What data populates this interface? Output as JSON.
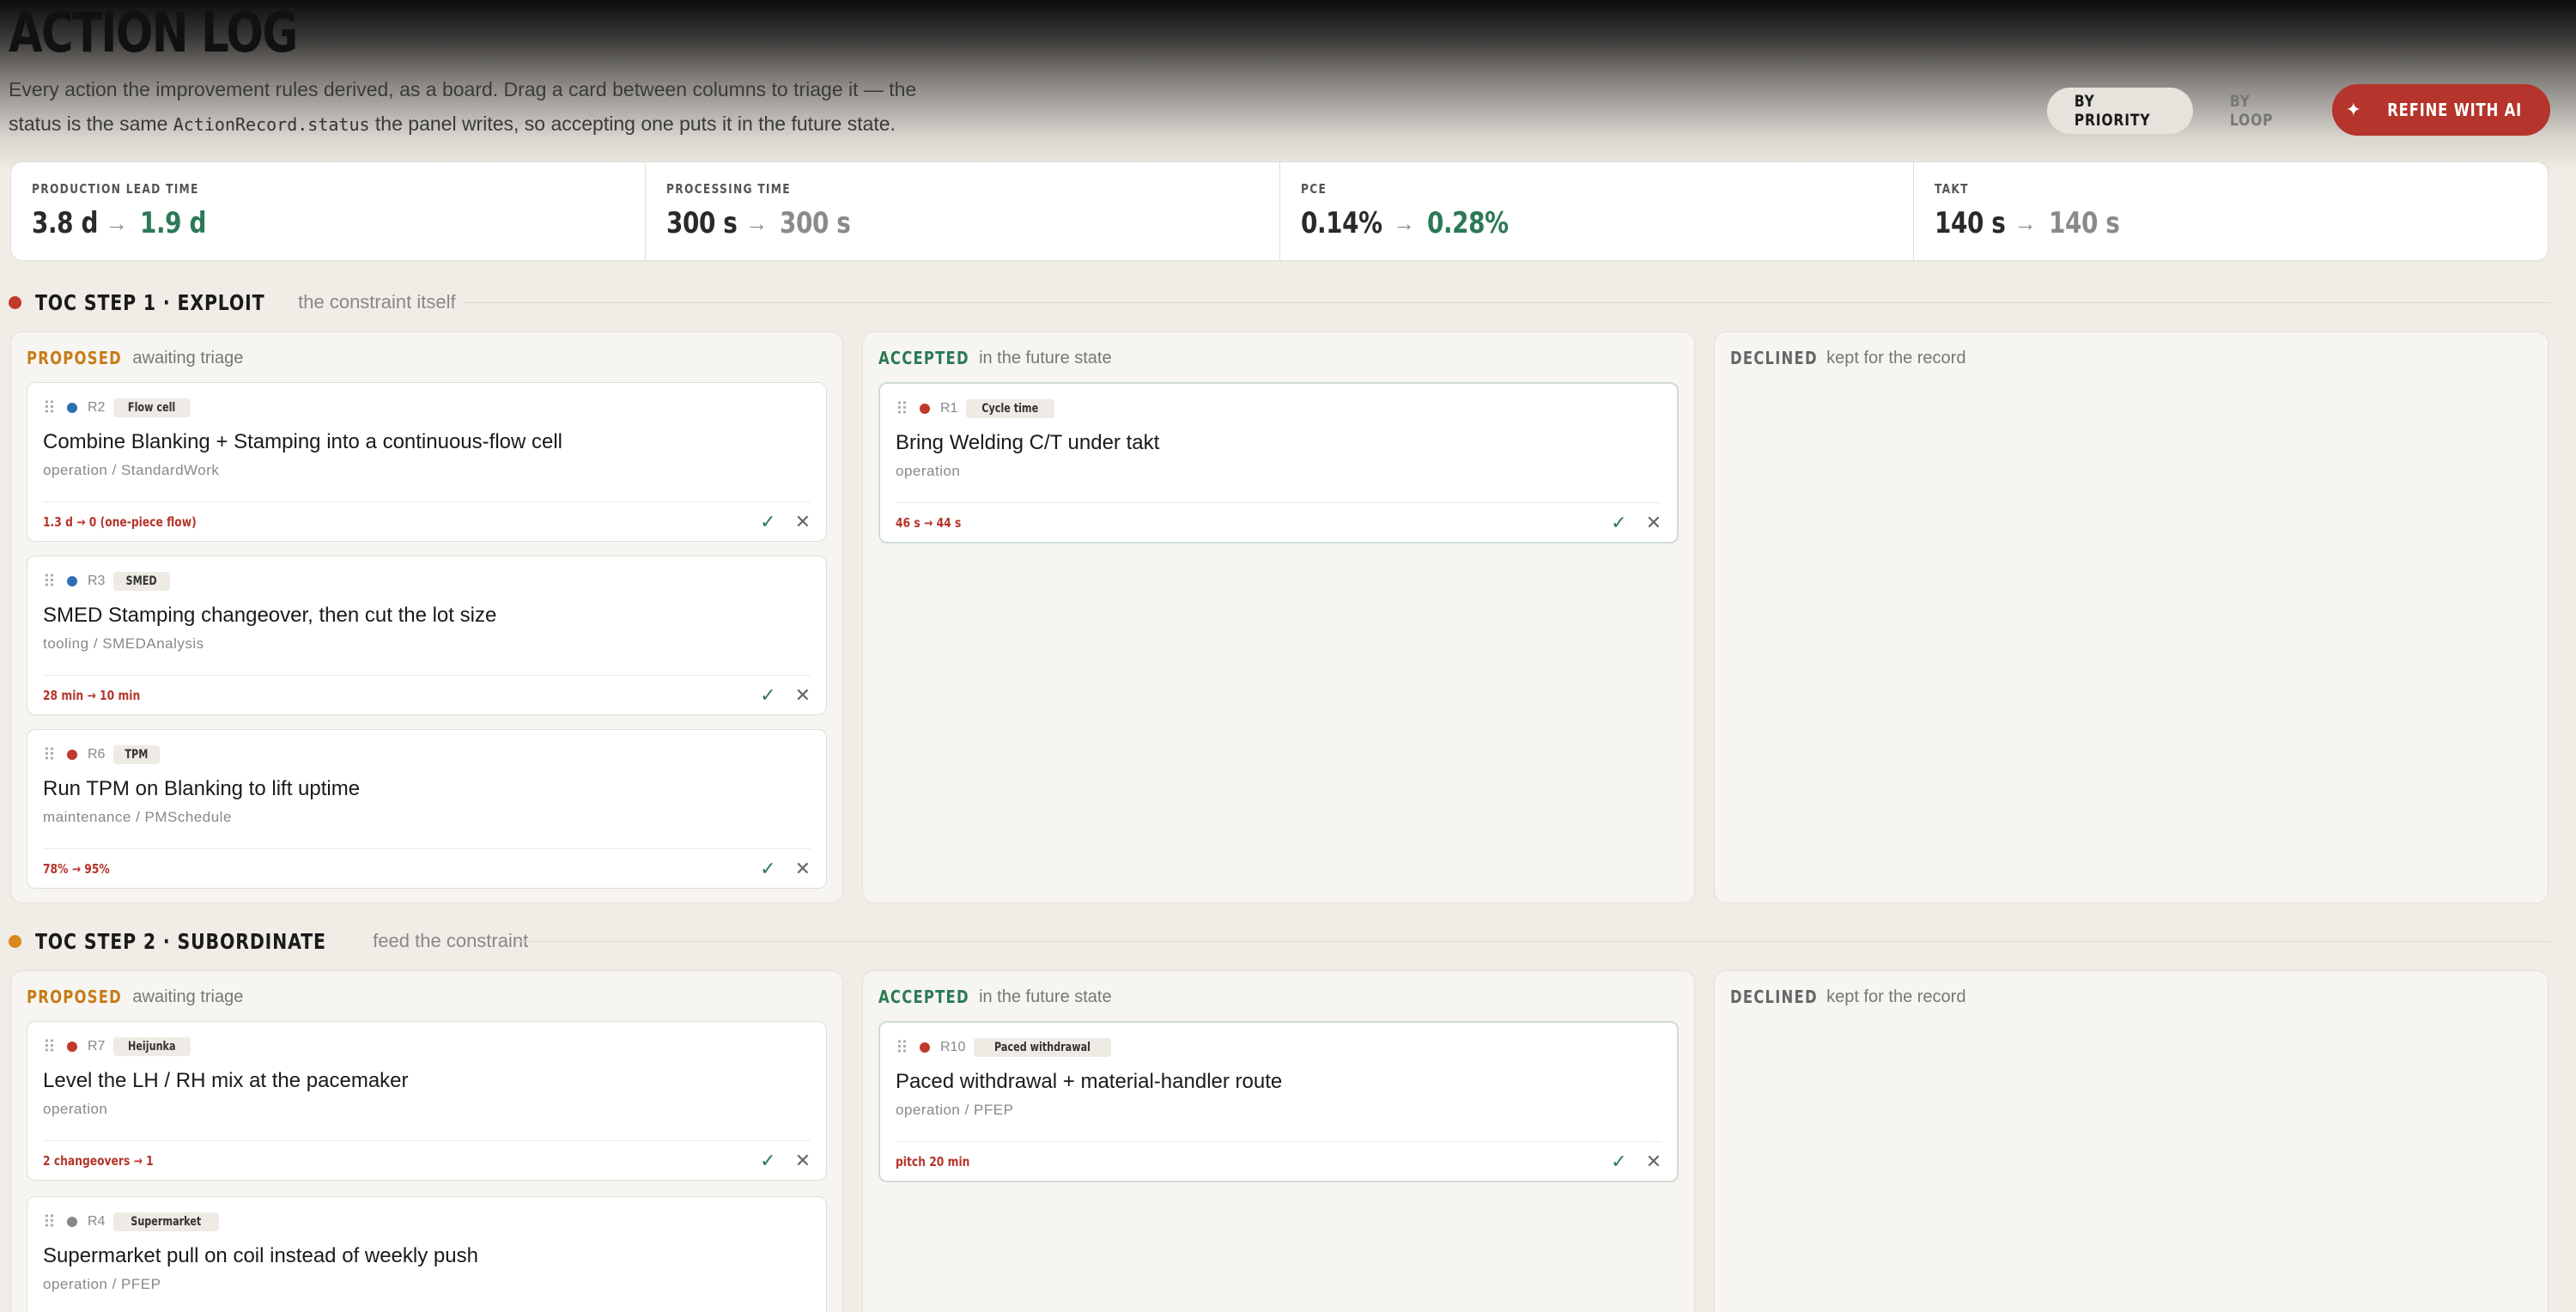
{
  "header": {
    "title": "ACTION LOG",
    "desc_1": "Every action the improvement rules derived, as a board. Drag a card between columns to triage it — the",
    "desc_2a": "status is the same ",
    "desc_code": "ActionRecord.status",
    "desc_2b": " the panel writes, so accepting one puts it in the future state.",
    "by_priority": "BY PRIORITY",
    "by_loop": "BY LOOP",
    "refine": "REFINE WITH AI"
  },
  "metrics": [
    {
      "label": "PRODUCTION LEAD TIME",
      "from": "3.8 d",
      "to": "1.9 d"
    },
    {
      "label": "PROCESSING TIME",
      "from": "300 s",
      "to": "300 s"
    },
    {
      "label": "PCE",
      "from": "0.14%",
      "to": "0.28%"
    },
    {
      "label": "TAKT",
      "from": "140 s",
      "to": "140 s"
    }
  ],
  "columns": {
    "proposed": {
      "title": "PROPOSED",
      "sub": "awaiting triage"
    },
    "accepted": {
      "title": "ACCEPTED",
      "sub": "in the future state"
    },
    "declined": {
      "title": "DECLINED",
      "sub": "kept for the record"
    }
  },
  "sections": [
    {
      "title": "TOC STEP 1 · EXPLOIT",
      "sub": "the constraint itself",
      "proposed": [
        {
          "id": "R2",
          "tag": "Flow cell",
          "title": "Combine Blanking + Stamping into a continuous-flow cell",
          "meta": "operation / StandardWork",
          "delta": "1.3 d → 0 (one-piece flow)"
        },
        {
          "id": "R3",
          "tag": "SMED",
          "title": "SMED Stamping changeover, then cut the lot size",
          "meta": "tooling / SMEDAnalysis",
          "delta": "28 min → 10 min"
        },
        {
          "id": "R6",
          "tag": "TPM",
          "title": "Run TPM on Blanking to lift uptime",
          "meta": "maintenance / PMSchedule",
          "delta": "78% → 95%"
        }
      ],
      "accepted": [
        {
          "id": "R1",
          "tag": "Cycle time",
          "title": "Bring Welding C/T under takt",
          "meta": "operation",
          "delta": "46 s → 44 s"
        }
      ]
    },
    {
      "title": "TOC STEP 2 · SUBORDINATE",
      "sub": "feed the constraint",
      "proposed": [
        {
          "id": "R7",
          "tag": "Heijunka",
          "title": "Level the LH / RH mix at the pacemaker",
          "meta": "operation",
          "delta": "2 changeovers → 1"
        },
        {
          "id": "R4",
          "tag": "Supermarket",
          "title": "Supermarket pull on coil instead of weekly push",
          "meta": "operation / PFEP",
          "delta": ""
        }
      ],
      "accepted": [
        {
          "id": "R10",
          "tag": "Paced withdrawal",
          "title": "Paced withdrawal + material-handler route",
          "meta": "operation / PFEP",
          "delta": "pitch 20 min"
        }
      ]
    }
  ],
  "glyphs": {
    "arrow": "→",
    "grip": "⠿",
    "accept": "✓",
    "decline": "✕",
    "sparkle": "✦"
  },
  "colors": {
    "accent": "#b5342b",
    "good": "#2b7a55",
    "proposed": "#c77b16",
    "bg": "#f0ece6"
  }
}
